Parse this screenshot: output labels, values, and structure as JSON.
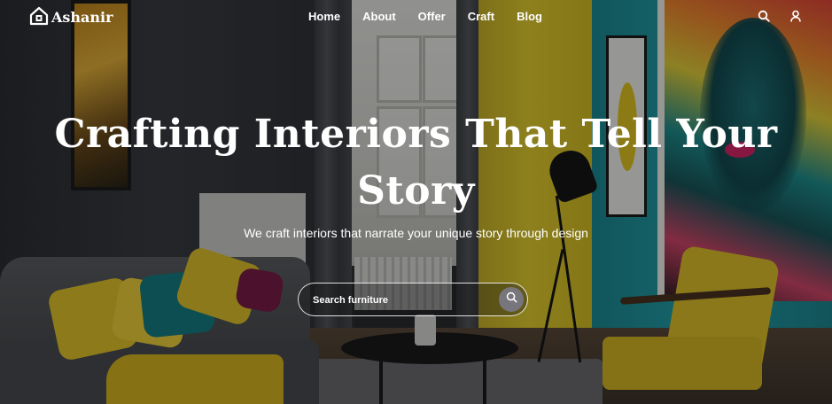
{
  "brand": {
    "name": "Ashanir",
    "icon": "house-icon"
  },
  "nav": {
    "items": [
      {
        "label": "Home"
      },
      {
        "label": "About"
      },
      {
        "label": "Offer"
      },
      {
        "label": "Craft"
      },
      {
        "label": "Blog"
      }
    ]
  },
  "header_icons": {
    "search": "search-icon",
    "user": "user-icon"
  },
  "hero": {
    "title": "Crafting Interiors That Tell Your Story",
    "subtitle": "We craft interiors that narrate your unique story through design"
  },
  "search": {
    "placeholder": "Search furniture",
    "value": "",
    "button_icon": "search-icon"
  },
  "colors": {
    "text": "#ffffff",
    "search_button": "#77767c",
    "accent_yellow": "#e3c623",
    "accent_teal": "#1f97a1"
  }
}
